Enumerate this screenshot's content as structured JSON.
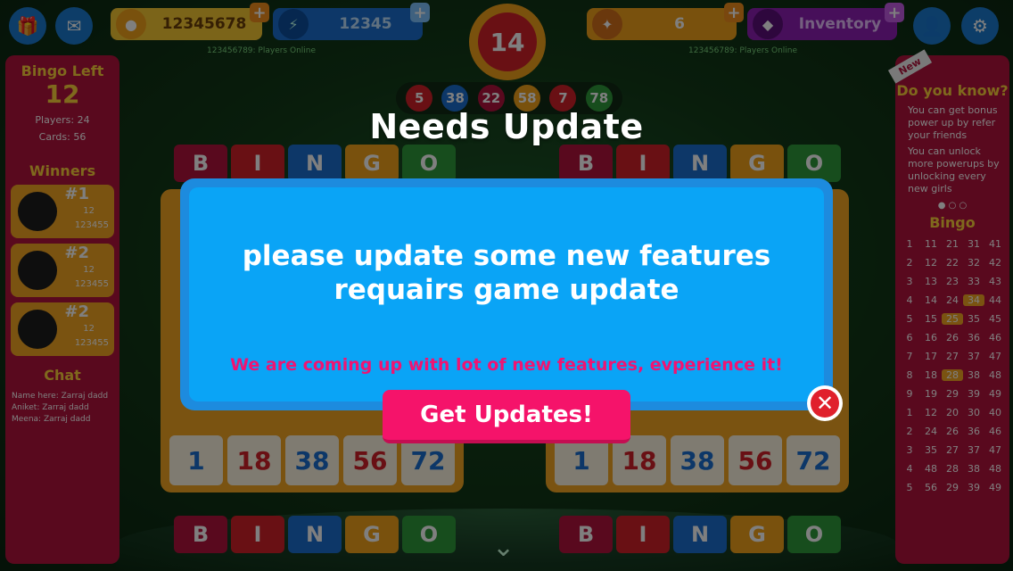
{
  "topbar": {
    "coins": "12345678",
    "energy": "12345",
    "powerups": "6",
    "inventory": "Inventory",
    "players_online_left": "123456789: Players Online",
    "players_online_right": "123456789: Players Online",
    "timer": "14"
  },
  "called_numbers": [
    "5",
    "38",
    "22",
    "58",
    "7",
    "78"
  ],
  "left_panel": {
    "bingo_left_label": "Bingo Left",
    "bingo_left_value": "12",
    "players": "Players: 24",
    "cards": "Cards: 56",
    "winners_label": "Winners",
    "winners": [
      {
        "rank": "#1",
        "a": "12",
        "b": "123455"
      },
      {
        "rank": "#2",
        "a": "12",
        "b": "123455"
      },
      {
        "rank": "#2",
        "a": "12",
        "b": "123455"
      }
    ],
    "chat_label": "Chat",
    "chat": [
      "Name here: Zarraj dadd",
      "Aniket: Zarraj dadd",
      "Meena: Zarraj dadd"
    ]
  },
  "right_panel": {
    "new_tag": "New",
    "did_you_know": "Do you know?",
    "tips": [
      "You can get bonus power up by refer your friends",
      "You can unlock more powerups by unlocking every new girls"
    ],
    "dots": "● ○ ○",
    "bingo_label": "Bingo",
    "table": [
      [
        "1",
        "11",
        "21",
        "31",
        "41"
      ],
      [
        "2",
        "12",
        "22",
        "32",
        "42"
      ],
      [
        "3",
        "13",
        "23",
        "33",
        "43"
      ],
      [
        "4",
        "14",
        "24",
        "34",
        "44"
      ],
      [
        "5",
        "15",
        "25",
        "35",
        "45"
      ],
      [
        "6",
        "16",
        "26",
        "36",
        "46"
      ],
      [
        "7",
        "17",
        "27",
        "37",
        "47"
      ],
      [
        "8",
        "18",
        "28",
        "38",
        "48"
      ],
      [
        "9",
        "19",
        "29",
        "39",
        "49"
      ],
      [
        "1",
        "12",
        "20",
        "30",
        "40"
      ],
      [
        "2",
        "24",
        "26",
        "36",
        "46"
      ],
      [
        "3",
        "35",
        "27",
        "37",
        "47"
      ],
      [
        "4",
        "48",
        "28",
        "38",
        "48"
      ],
      [
        "5",
        "56",
        "29",
        "39",
        "49"
      ]
    ]
  },
  "bingo_letters": [
    "B",
    "I",
    "N",
    "G",
    "O"
  ],
  "card_bottom_row": [
    "1",
    "18",
    "38",
    "56",
    "72"
  ],
  "modal": {
    "title": "Needs Update",
    "message_line1": "please update some new features",
    "message_line2": "requairs game update",
    "sub_message": "We are coming up with lot of new features, evperience it!",
    "button": "Get Updates!",
    "close": "✕"
  },
  "colors": {
    "modal_bg": "#0aa4f6",
    "button": "#f5136a",
    "panel": "#b3133d",
    "card": "#f5a623"
  }
}
